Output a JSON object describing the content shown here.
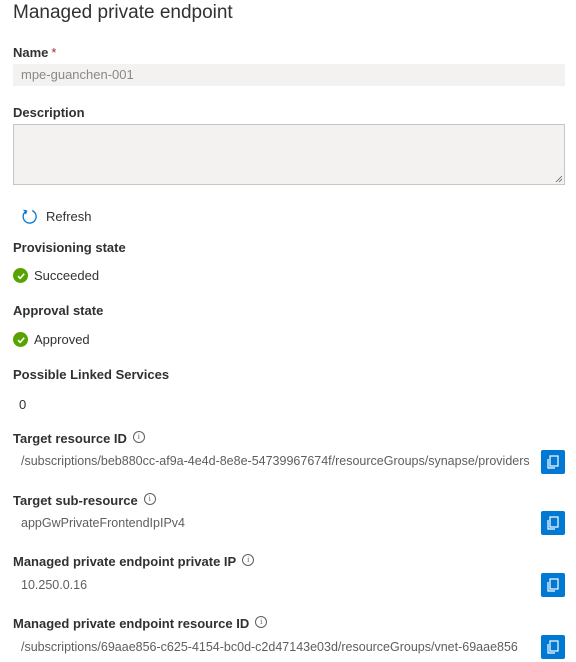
{
  "page": {
    "title": "Managed private endpoint"
  },
  "name": {
    "label": "Name",
    "required_mark": "*",
    "value": "mpe-guanchen-001"
  },
  "description": {
    "label": "Description",
    "value": ""
  },
  "refresh": {
    "label": "Refresh",
    "icon": "refresh-icon"
  },
  "provisioning": {
    "label": "Provisioning state",
    "value": "Succeeded",
    "status_color": "#57a300"
  },
  "approval": {
    "label": "Approval state",
    "value": "Approved",
    "status_color": "#57a300"
  },
  "linked_services": {
    "label": "Possible Linked Services",
    "value": "0"
  },
  "target_resource": {
    "label": "Target resource ID",
    "value": "/subscriptions/beb880cc-af9a-4e4d-8e8e-54739967674f/resourceGroups/synapse/providers"
  },
  "target_sub_resource": {
    "label": "Target sub-resource",
    "value": "appGwPrivateFrontendIpIPv4"
  },
  "private_ip": {
    "label": "Managed private endpoint private IP",
    "value": "10.250.0.16"
  },
  "endpoint_resource": {
    "label": "Managed private endpoint resource ID",
    "value": "/subscriptions/69aae856-c625-4154-bc0d-c2d47143e03d/resourceGroups/vnet-69aae856"
  },
  "colors": {
    "accent": "#0078d4",
    "success": "#57a300",
    "required": "#a4262c"
  }
}
